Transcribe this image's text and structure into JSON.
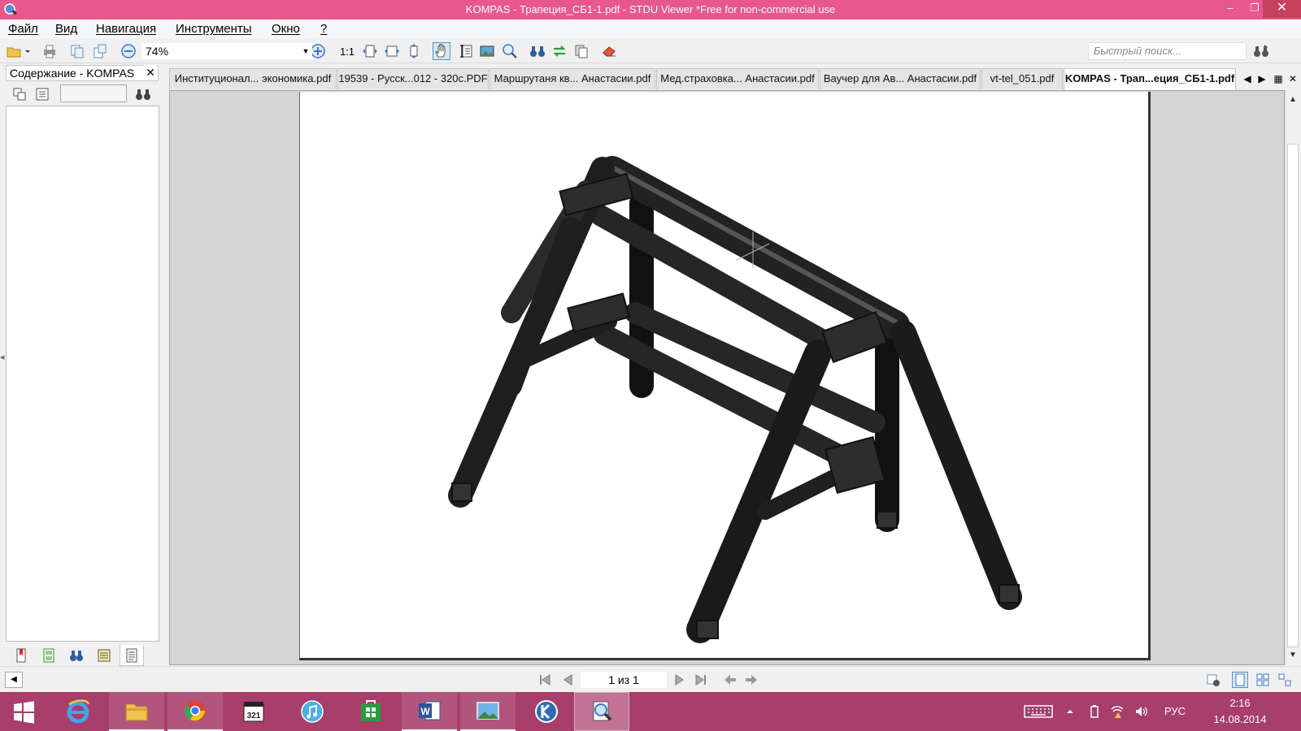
{
  "window": {
    "title": "KOMPAS - Трапеция_СБ1-1.pdf - STDU Viewer *Free for non-commercial use",
    "min_label": "–",
    "max_label": "❐",
    "close_label": "✕"
  },
  "menu": {
    "file": "Файл",
    "view": "Вид",
    "navigation": "Навигация",
    "tools": "Инструменты",
    "window": "Окно",
    "help": "?"
  },
  "toolbar": {
    "zoom_value": "74%",
    "actual_size_label": "1:1",
    "quick_search_placeholder": "Быстрый поиск..."
  },
  "left_panel": {
    "tab_title": "Содержание - KOMPAS",
    "close_label": "✕"
  },
  "doc_tabs": [
    {
      "label": "Институционал... экономика.pdf",
      "active": false
    },
    {
      "label": "19539 - Русск...012 - 320с.PDF",
      "active": false
    },
    {
      "label": "Маршрутаня кв... Анастасии.pdf",
      "active": false
    },
    {
      "label": "Мед.страховка... Анастасии.pdf",
      "active": false
    },
    {
      "label": "Ваучер для Ав... Анастасии.pdf",
      "active": false
    },
    {
      "label": "vt-tel_051.pdf",
      "active": false
    },
    {
      "label": "KOMPAS - Трап...еция_СБ1-1.pdf",
      "active": true
    }
  ],
  "status": {
    "page_indicator": "1 из 1"
  },
  "taskbar": {
    "language": "РУС",
    "time": "2:16",
    "date": "14.08.2014"
  },
  "colors": {
    "titlebar": "#e8588c",
    "taskbar": "#a83e6a",
    "accent": "#5b90c8"
  }
}
